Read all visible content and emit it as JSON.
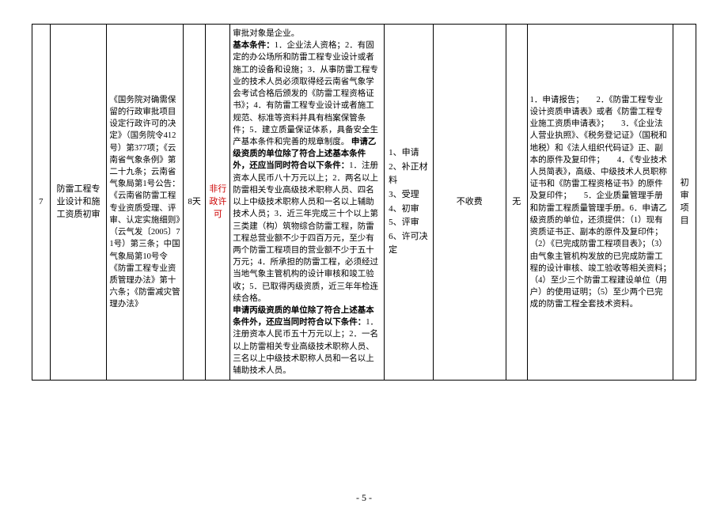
{
  "row": {
    "index": "7",
    "item_name": "防雷工程专业设计和施工资质初审",
    "basis": "《国务院对确需保留的行政审批项目设定行政许可的决定》（国务院令412号）第377项；《云南省气象条例》第二十九条；云南省气象局第1号公告：《云南省防雷工程专业资质受理、评审、认定实施细则》（云气发〔2005〕71号）第三条；中国气象局第10号令《防雷工程专业资质管理办法》第十六条；《防雷减灾管理办法》",
    "time_limit": "8天",
    "type": "非行政许可",
    "conditions_intro": "审批对象是企业。",
    "conditions_basic_label": "基本条件：",
    "conditions_basic": "1．企业法人资格；2．有固定的办公场所和防雷工程专业设计或者施工的设备和设施；3．从事防雷工程专业的技术人员必须取得经云南省气象学会考试合格后颁发的《防雷工程资格证书》；4．有防雷工程专业设计或者施工规范、标准等资料并具有档案保管条件；5．建立质量保证体系，具备安全生产基本条件和完善的规章制度。",
    "conditions_yi_label": "申请乙级资质的单位除了符合上述基本条件外，还应当同时符合以下条件：",
    "conditions_yi": "1．注册资本人民币八十万元以上；2．两名以上防雷相关专业高级技术职称人员、四名以上中级技术职称人员和一名以上辅助技术人员；3．近三年完成三十个以上第三类建（构）筑物综合防雷工程，防雷工程总营业额不少于四百万元，至少有两个防雷工程项目的营业额不少于五十万元；4．所承担的防雷工程，必须经过当地气象主管机构的设计审核和竣工验收；5．已取得丙级资质，近三年年检连续合格。",
    "conditions_bing_label": "申请丙级资质的单位除了符合上述基本条件外，还应当同时符合以下条件：",
    "conditions_bing": "1．注册资本人民币五十万元以上；2．一名以上防雷相关专业高级技术职称人员、三名以上中级技术职称人员和一名以上辅助技术人员。",
    "procedure": {
      "p1": "1、申请",
      "p2": "2、补正材料",
      "p3": "3、受理",
      "p4": "4、初审",
      "p5": "5、评审",
      "p6": "6、许可决定"
    },
    "fee": "不收费",
    "fee_basis": "无",
    "materials": "1．申请报告；　　2．《防雷工程专业设计资质申请表》或者《防雷工程专业施工资质申请表》；　　3．《企业法人营业执照》、《税务登记证》（国税和地税）和《法人组织代码证》正、副本的原件及复印件；　　4．《专业技术人员简表》，高级、中级技术人员职称证书和《防雷工程资格证书》的原件及复印件；　　5．企业质量管理手册和防雷工程质量管理手册。6．申请乙级资质的单位，还须提供：（1）现有资质证书正、副本的原件及复印件；（2）《已完成防雷工程项目表》；（3）由气象主管机构发放的已完成防雷工程的设计审核、竣工验收等相关资料；　　（4）至少三个防雷工程建设单位（用户）的使用证明；（5）至少两个已完成的防雷工程全套技术资料。",
    "remark": "初审项目"
  },
  "page_label": "- 5 -"
}
